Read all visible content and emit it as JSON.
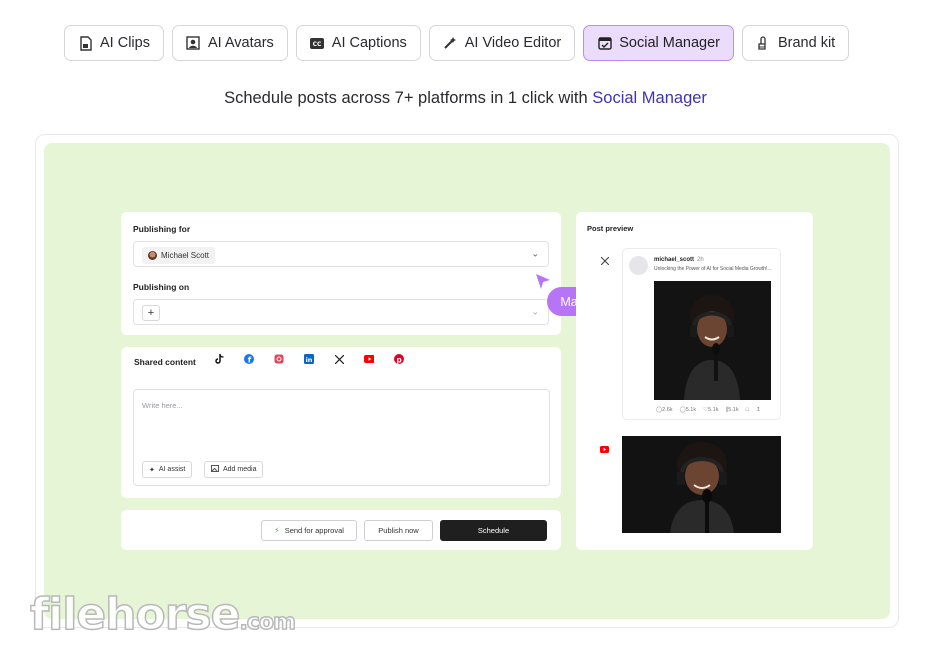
{
  "tabs": [
    {
      "label": "AI Clips",
      "icon": "clip-file-icon",
      "active": false
    },
    {
      "label": "AI Avatars",
      "icon": "avatar-portrait-icon",
      "active": false
    },
    {
      "label": "AI Captions",
      "icon": "cc-captions-icon",
      "active": false
    },
    {
      "label": "AI Video Editor",
      "icon": "magic-wand-icon",
      "active": false
    },
    {
      "label": "Social Manager",
      "icon": "calendar-check-icon",
      "active": true
    },
    {
      "label": "Brand kit",
      "icon": "paint-brush-icon",
      "active": false
    }
  ],
  "subtitle": {
    "text": "Schedule posts across 7+ platforms in 1 click with ",
    "accent": "Social Manager"
  },
  "form": {
    "publishing_for_label": "Publishing for",
    "account_name": "Michael Scott",
    "publishing_on_label": "Publishing on",
    "plus_symbol": "+",
    "shared_content_label": "Shared content",
    "platforms": [
      "tiktok",
      "facebook",
      "instagram",
      "linkedin",
      "x",
      "youtube",
      "pinterest"
    ],
    "editor_placeholder": "Write here...",
    "ai_assist_label": "AI assist",
    "add_media_label": "Add media",
    "send_approval_label": "Send for approval",
    "publish_now_label": "Publish now",
    "schedule_label": "Schedule"
  },
  "collaborator": {
    "name": "Matt",
    "color": "#b774f5"
  },
  "preview": {
    "title": "Post preview",
    "tweet": {
      "username": "michael_scott",
      "time": "2h",
      "text": "Unlocking the Power of AI for Social Media Growth!...",
      "stats": [
        "2.6k",
        "5.1k",
        "5.1k",
        "5.1k"
      ]
    }
  },
  "watermark": {
    "main": "filehorse",
    "suffix": ".com"
  },
  "colors": {
    "accent": "#3f33b5",
    "active_tab_bg": "#ecdcfb",
    "panel_bg": "#e7f5d7",
    "cursor": "#b774f5"
  }
}
